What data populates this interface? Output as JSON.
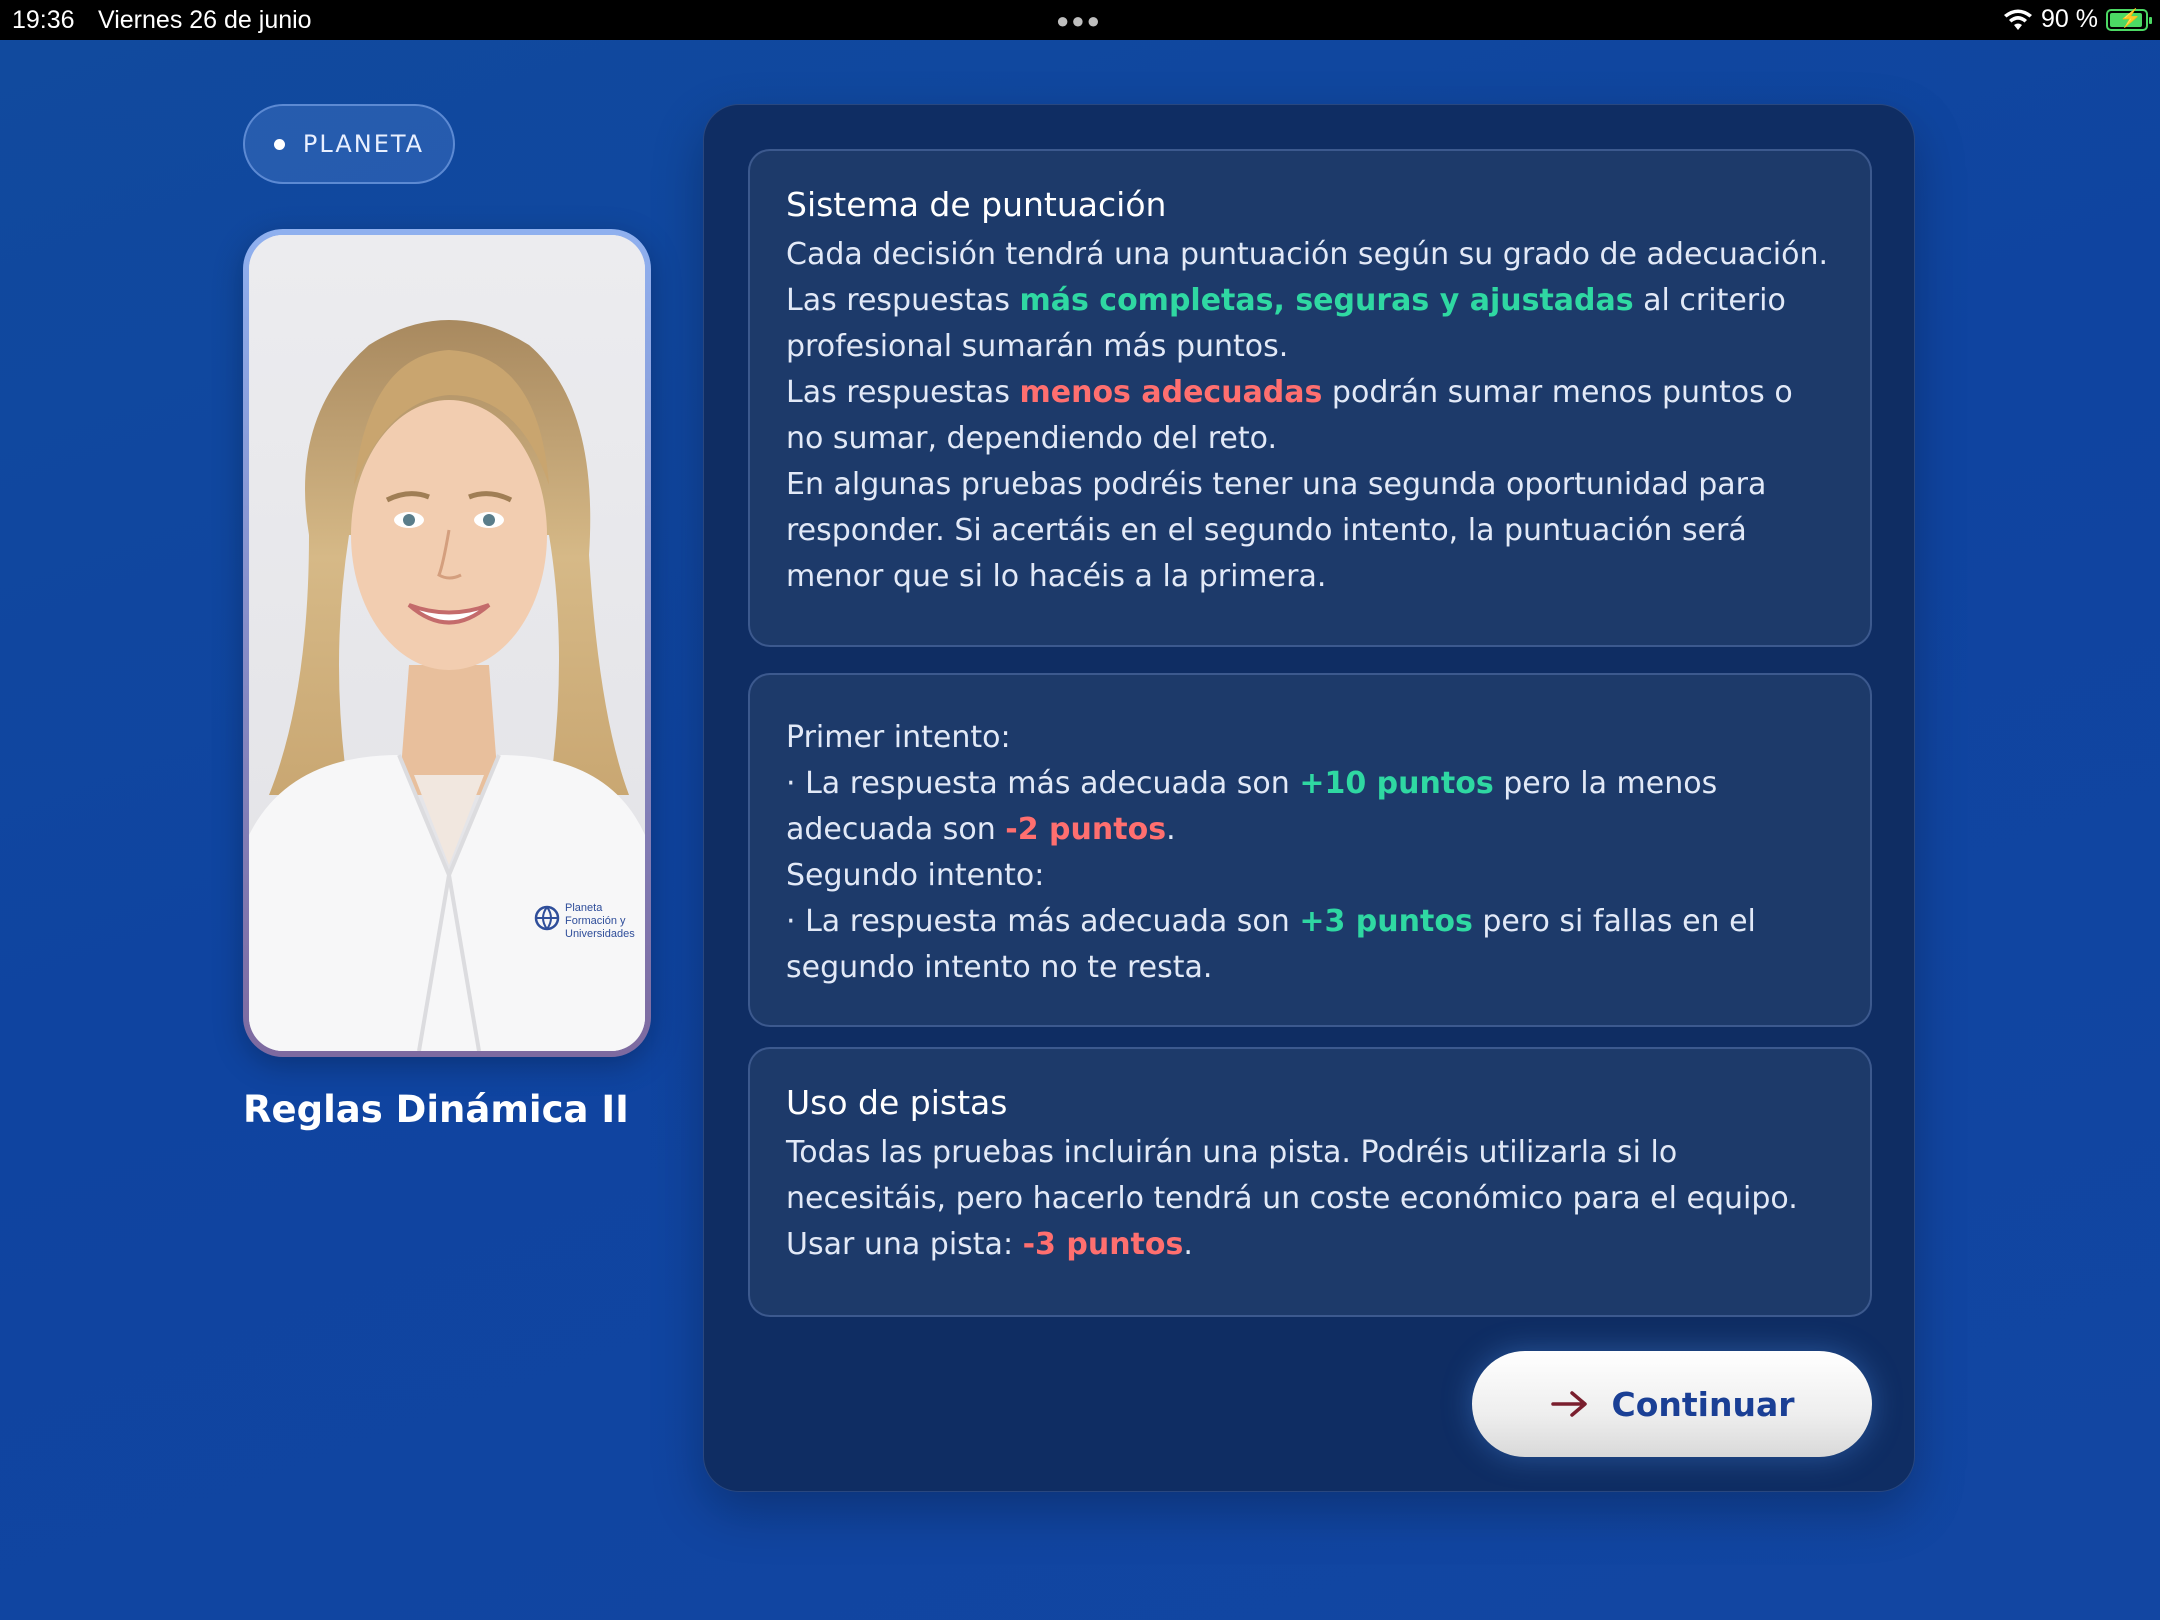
{
  "status_bar": {
    "time": "19:36",
    "date": "Viernes 26 de junio",
    "battery": "90 %"
  },
  "sidebar": {
    "chip_label": "PLANETA",
    "title": "Reglas Dinámica II",
    "coat_logo_lines": [
      "Planeta",
      "Formación y",
      "Universidades"
    ]
  },
  "scoring": {
    "title": "Sistema de puntuación",
    "p1_a": "Cada decisión tendrá una puntuación según su grado de adecuación. Las respuestas ",
    "p1_highlight": "más completas, seguras y ajustadas",
    "p1_b": " al criterio profesional sumarán más puntos.",
    "p2_a": "Las respuestas ",
    "p2_highlight": "menos adecuadas",
    "p2_b": " podrán sumar menos puntos o no sumar, dependiendo del reto.",
    "p3": "En algunas pruebas podréis tener una segunda oportunidad para responder. Si acertáis en el segundo intento, la puntuación será menor que si lo hacéis a la primera."
  },
  "attempts": {
    "first_label": "Primer intento:",
    "first_a": "· La respuesta más adecuada son ",
    "first_plus": "+10 puntos",
    "first_b": " pero la menos adecuada son ",
    "first_minus": "-2 puntos",
    "first_end": ".",
    "second_label": "Segundo intento:",
    "second_a": "· La respuesta más adecuada son ",
    "second_plus": "+3 puntos",
    "second_b": " pero si fallas en el segundo intento no te resta."
  },
  "hints": {
    "title": "Uso de pistas",
    "text": "Todas las pruebas incluirán una pista. Podréis utilizarla si lo necesitáis, pero hacerlo tendrá un coste económico para el equipo.",
    "use_a": "Usar una pista: ",
    "use_minus": "-3 puntos",
    "use_end": "."
  },
  "continue_button": {
    "label": "Continuar",
    "icon": "arrow-right-icon"
  },
  "colors": {
    "accent_green": "#2fd8a2",
    "accent_red": "#ff6f6f",
    "button_text": "#1a3f95"
  }
}
